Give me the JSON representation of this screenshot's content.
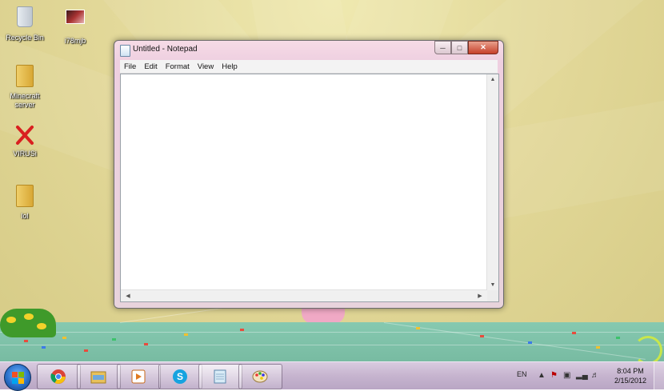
{
  "desktop": {
    "icons": [
      {
        "label": "Recycle Bin",
        "icon": "recycle-bin-icon"
      },
      {
        "label": "i78mjb",
        "icon": "photo-icon"
      },
      {
        "label": "Minecraft server",
        "icon": "folder-icon"
      },
      {
        "label": "VIRUSi",
        "icon": "red-x-icon"
      },
      {
        "label": "lol",
        "icon": "folder-icon"
      }
    ]
  },
  "window": {
    "title": "Untitled - Notepad",
    "menu": [
      "File",
      "Edit",
      "Format",
      "View",
      "Help"
    ],
    "editor_text": ""
  },
  "taskbar": {
    "pinned": [
      {
        "name": "chrome",
        "icon": "chrome-icon"
      },
      {
        "name": "explorer",
        "icon": "explorer-icon"
      },
      {
        "name": "media-player",
        "icon": "media-player-icon"
      },
      {
        "name": "skype",
        "icon": "skype-icon"
      },
      {
        "name": "notepad",
        "icon": "notepad-icon",
        "active": true
      },
      {
        "name": "paint",
        "icon": "paint-icon"
      }
    ],
    "tray": {
      "language": "EN",
      "time": "8:04 PM",
      "date": "2/15/2012"
    }
  },
  "colors": {
    "window_frame": "#eecfe0",
    "taskbar": "#c6b4cf",
    "desktop_bg": "#e3d99a",
    "floor": "#86c9b0"
  }
}
